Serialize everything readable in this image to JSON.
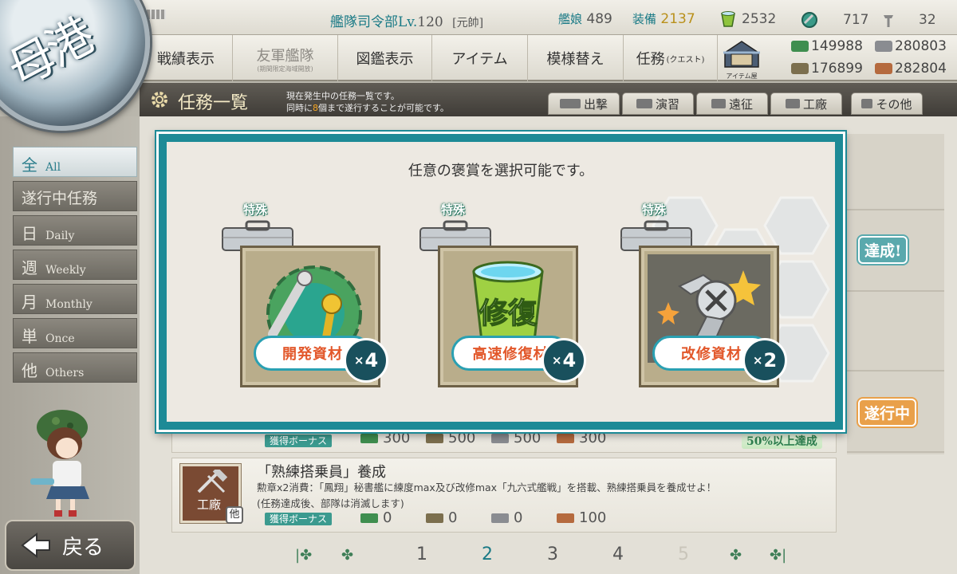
{
  "header": {
    "hq_label": "艦隊司令部Lv.",
    "hq_level": "120",
    "rank": "[元帥]",
    "ships_label": "艦娘",
    "ships_count": "489",
    "equip_label": "装備",
    "equip_count": "2137",
    "bucket_count": "2532",
    "dev_material_count": "717",
    "screw_count": "32"
  },
  "nav": {
    "items": [
      {
        "label": "戦績表示"
      },
      {
        "label": "友軍艦隊",
        "sub": "(期間限定海域開放)"
      },
      {
        "label": "図鑑表示"
      },
      {
        "label": "アイテム"
      },
      {
        "label": "模様替え"
      },
      {
        "label": "任務",
        "sub": "(クエスト)"
      }
    ],
    "item_shop_label": "アイテム屋"
  },
  "materials": {
    "fuel": "149988",
    "steel": "280803",
    "ammo": "176899",
    "bauxite": "282804"
  },
  "port": {
    "label": "母港"
  },
  "titlebar": {
    "title": "任務一覧",
    "desc_line1": "現在発生中の任務一覧です。",
    "desc_line2_pre": "同時に",
    "desc_line2_num": "8",
    "desc_line2_post": "個まで遂行することが可能です。",
    "tabs": [
      {
        "label": "出撃"
      },
      {
        "label": "演習"
      },
      {
        "label": "遠征"
      },
      {
        "label": "工廠"
      },
      {
        "label": "その他"
      }
    ]
  },
  "sidebar": {
    "items": [
      {
        "kanji": "全",
        "en": "All"
      },
      {
        "kanji": "遂行中任務",
        "en": ""
      },
      {
        "kanji": "日",
        "en": "Daily"
      },
      {
        "kanji": "週",
        "en": "Weekly"
      },
      {
        "kanji": "月",
        "en": "Monthly"
      },
      {
        "kanji": "単",
        "en": "Once"
      },
      {
        "kanji": "他",
        "en": "Others"
      }
    ],
    "back_label": "戻る"
  },
  "modal": {
    "title": "任意の褒賞を選択可能です。",
    "choices": [
      {
        "tag": "特殊",
        "name": "開発資材",
        "count": "4"
      },
      {
        "tag": "特殊",
        "name": "高速修復材",
        "count": "4",
        "art_text": "修復"
      },
      {
        "tag": "特殊",
        "name": "改修資材",
        "count": "2"
      }
    ]
  },
  "quests": {
    "q1": {
      "bonus_label": "獲得ボーナス",
      "fuel": "300",
      "ammo": "500",
      "steel": "500",
      "bauxite": "300",
      "rate_badge": "50%以上達成"
    },
    "q2": {
      "category": "工廠",
      "category_badge": "他",
      "title": "「熟練搭乗員」養成",
      "desc_line1": "勲章x2消費：「鳳翔」秘書艦に練度max及び改修max「九六式艦戦」を搭載、熟練搭乗員を養成せよ！",
      "desc_line2": "(任務達成後、部隊は消滅します)",
      "bonus_label": "獲得ボーナス",
      "fuel": "0",
      "ammo": "0",
      "steel": "0",
      "bauxite": "100"
    }
  },
  "status_stamps": {
    "done": "達成!",
    "in_progress": "遂行中"
  },
  "pagination": {
    "pages": [
      "1",
      "2",
      "3",
      "4",
      "5"
    ],
    "current": "2"
  },
  "colors": {
    "accent": "#1d8a96",
    "gold": "#b9901b",
    "orange_text": "#e2572a"
  }
}
